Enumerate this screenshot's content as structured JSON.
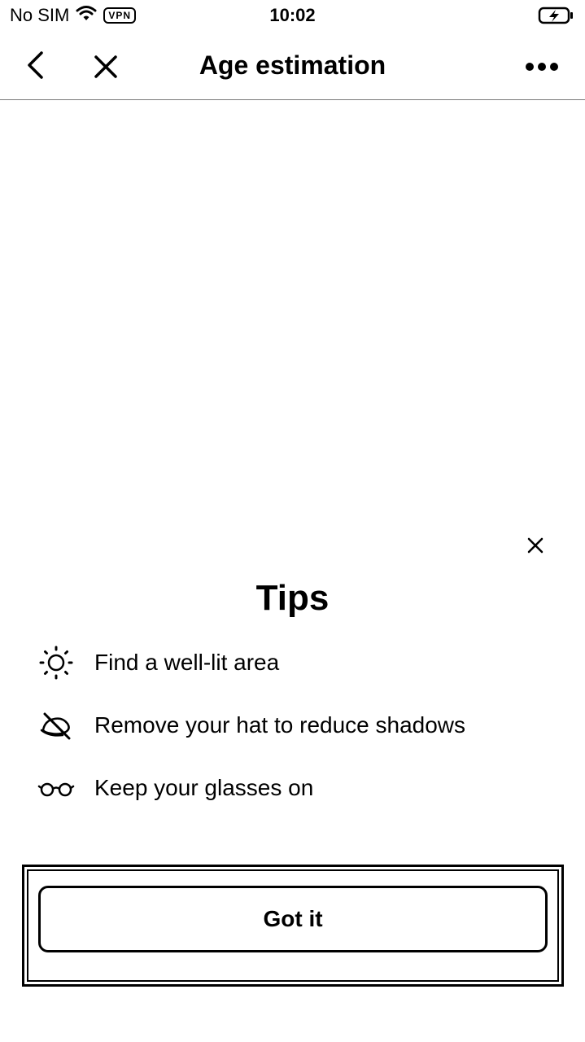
{
  "status_bar": {
    "carrier": "No SIM",
    "wifi_icon": "wifi-icon",
    "vpn": "VPN",
    "time": "10:02",
    "battery_icon": "battery-charging-icon"
  },
  "nav": {
    "back_icon": "chevron-left-icon",
    "close_icon": "close-icon",
    "title": "Age estimation",
    "more_icon": "more-horizontal-icon"
  },
  "tips_sheet": {
    "close_icon": "close-icon",
    "title": "Tips",
    "items": [
      {
        "icon": "sun-icon",
        "text": "Find a well-lit area"
      },
      {
        "icon": "hat-off-icon",
        "text": "Remove your hat to reduce shadows"
      },
      {
        "icon": "glasses-icon",
        "text": "Keep your glasses on"
      }
    ],
    "button_label": "Got it"
  },
  "colors": {
    "background": "#ffffff",
    "foreground": "#000000",
    "divider": "#7a7a7a"
  }
}
